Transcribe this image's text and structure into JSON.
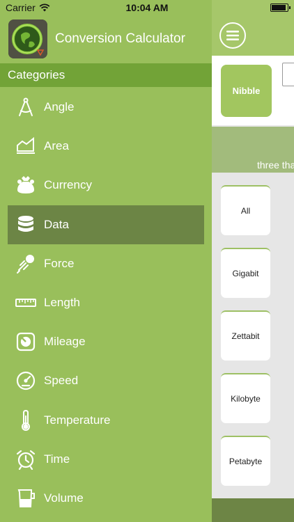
{
  "status": {
    "carrier": "Carrier",
    "time": "10:04 AM"
  },
  "app": {
    "title": "Conversion Calculator"
  },
  "drawer": {
    "section_title": "Categories",
    "items": [
      {
        "label": "Angle",
        "icon": "compass-icon"
      },
      {
        "label": "Area",
        "icon": "area-chart-icon"
      },
      {
        "label": "Currency",
        "icon": "money-bag-icon"
      },
      {
        "label": "Data",
        "icon": "database-icon",
        "active": true
      },
      {
        "label": "Force",
        "icon": "force-icon"
      },
      {
        "label": "Length",
        "icon": "ruler-icon"
      },
      {
        "label": "Mileage",
        "icon": "mileage-icon"
      },
      {
        "label": "Speed",
        "icon": "speedometer-icon"
      },
      {
        "label": "Temperature",
        "icon": "thermometer-icon"
      },
      {
        "label": "Time",
        "icon": "alarm-clock-icon"
      },
      {
        "label": "Volume",
        "icon": "beaker-icon"
      }
    ]
  },
  "main": {
    "selected_unit": "Nibble",
    "result_text": "three tha",
    "units": [
      "All",
      "Gigabit",
      "Zettabit",
      "Kilobyte",
      "Petabyte"
    ]
  },
  "colors": {
    "drawer_bg": "#99bf5b",
    "categories_bar": "#72a337",
    "active_item": "#6c8545",
    "accent": "#a2c65f"
  }
}
